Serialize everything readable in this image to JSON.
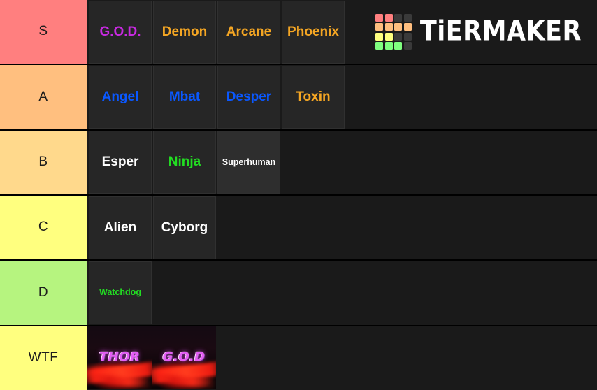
{
  "app": {
    "name": "TierMaker",
    "logo_text": "TiERMAKER",
    "logo_grid_colors": [
      "#ff7f7f",
      "#ff7f7f",
      "#3a3a3a",
      "#3a3a3a",
      "#ffbf7f",
      "#ffbf7f",
      "#ffbf7f",
      "#ffbf7f",
      "#ffff7f",
      "#ffff7f",
      "#3a3a3a",
      "#3a3a3a",
      "#7fff7f",
      "#7fff7f",
      "#7fff7f",
      "#3a3a3a"
    ]
  },
  "palette": {
    "row_background": "#1a1a1a",
    "tile_background": "#262626",
    "divider": "#000000",
    "orange_text": "#f5a623",
    "blue_text": "#0a58ff",
    "green_text": "#22dd22",
    "magenta_text": "#c72ae0",
    "white_text": "#ffffff"
  },
  "tiers": [
    {
      "label": "S",
      "color": "#ff7f7f",
      "items": [
        {
          "text": "G.O.D.",
          "color": "#c72ae0",
          "style": "bold",
          "size": "normal",
          "tile_bg": "#262626"
        },
        {
          "text": "Demon",
          "color": "#f5a623",
          "style": "bold",
          "size": "normal",
          "tile_bg": "#262626"
        },
        {
          "text": "Arcane",
          "color": "#f5a623",
          "style": "bold",
          "size": "normal",
          "tile_bg": "#262626"
        },
        {
          "text": "Phoenix",
          "color": "#f5a623",
          "style": "bold",
          "size": "normal",
          "tile_bg": "#262626"
        }
      ]
    },
    {
      "label": "A",
      "color": "#ffbf7f",
      "items": [
        {
          "text": "Angel",
          "color": "#0a58ff",
          "style": "bold",
          "size": "normal",
          "tile_bg": "#262626"
        },
        {
          "text": "Mbat",
          "color": "#0a58ff",
          "style": "bold",
          "size": "normal",
          "tile_bg": "#262626"
        },
        {
          "text": "Desper",
          "color": "#0a58ff",
          "style": "bold",
          "size": "normal",
          "tile_bg": "#262626"
        },
        {
          "text": "Toxin",
          "color": "#f5a623",
          "style": "bold",
          "size": "normal",
          "tile_bg": "#262626"
        }
      ]
    },
    {
      "label": "B",
      "color": "#ffd98c",
      "items": [
        {
          "text": "Esper",
          "color": "#ffffff",
          "style": "bold",
          "size": "normal",
          "tile_bg": "#262626"
        },
        {
          "text": "Ninja",
          "color": "#22dd22",
          "style": "bold",
          "size": "normal",
          "tile_bg": "#262626"
        },
        {
          "text": "Superhuman",
          "color": "#ffffff",
          "style": "bold",
          "size": "small",
          "tile_bg": "#2e2e2e"
        }
      ]
    },
    {
      "label": "C",
      "color": "#ffff7f",
      "items": [
        {
          "text": "Alien",
          "color": "#ffffff",
          "style": "bold",
          "size": "normal",
          "tile_bg": "#262626"
        },
        {
          "text": "Cyborg",
          "color": "#ffffff",
          "style": "bold",
          "size": "normal",
          "tile_bg": "#262626"
        }
      ]
    },
    {
      "label": "D",
      "color": "#b6f47f",
      "items": [
        {
          "text": "Watchdog",
          "color": "#22dd22",
          "style": "bold",
          "size": "small",
          "tile_bg": "#262626"
        }
      ]
    },
    {
      "label": "WTF",
      "color": "#ffff7f",
      "items": [
        {
          "text": "THOR",
          "color": "#e45cf5",
          "style": "artwork",
          "size": "normal",
          "tile_bg": "#0a0609"
        },
        {
          "text": "G.O.D",
          "color": "#e45cf5",
          "style": "artwork",
          "size": "normal",
          "tile_bg": "#0a0609"
        }
      ]
    }
  ]
}
